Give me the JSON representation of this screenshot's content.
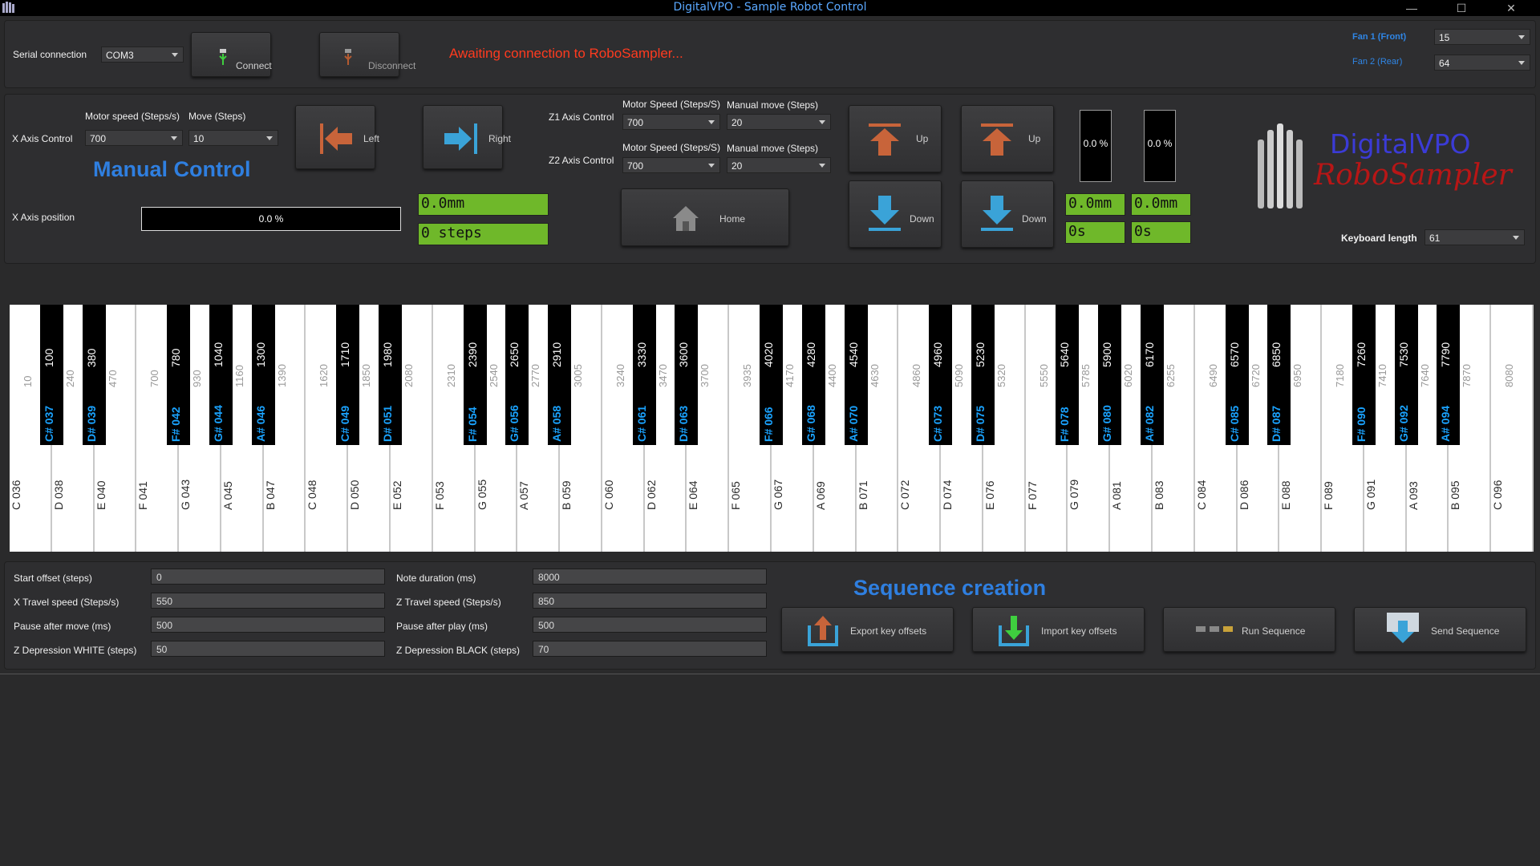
{
  "window": {
    "title": "DigitalVPO - Sample Robot Control",
    "minimize": "—",
    "maximize": "☐",
    "close": "✕"
  },
  "connection": {
    "serial_label": "Serial connection",
    "port_value": "COM3",
    "connect_label": "Connect",
    "disconnect_label": "Disconnect",
    "status_text": "Awaiting connection to RoboSampler...",
    "status_color": "#ff3b1f",
    "fan1_label": "Fan 1 (Front)",
    "fan1_value": "15",
    "fan2_label": "Fan 2 (Rear)",
    "fan2_value": "64"
  },
  "manual": {
    "heading": "Manual Control",
    "x_axis_label": "X Axis Control",
    "motor_speed_label": "Motor speed (Steps/s)",
    "motor_speed_value": "700",
    "move_label": "Move (Steps)",
    "move_value": "10",
    "left_label": "Left",
    "right_label": "Right",
    "x_position_label": "X Axis position",
    "x_position_value": "0.0 %",
    "x_position_fraction": 0.0,
    "x_mm": "0.0mm",
    "x_steps": "0 steps",
    "z1_label": "Z1 Axis Control",
    "z2_label": "Z2 Axis Control",
    "z_motor_speed_label": "Motor Speed (Steps/S)",
    "z_manual_move_label": "Manual move (Steps)",
    "z1_speed": "700",
    "z1_move": "20",
    "z2_speed": "700",
    "z2_move": "20",
    "home_label": "Home",
    "up_label": "Up",
    "down_label": "Down",
    "z1_pct": "0.0 %",
    "z2_pct": "0.0 %",
    "z1_mm": "0.0mm",
    "z2_mm": "0.0mm",
    "z1_time": "0s",
    "z2_time": "0s",
    "logo_line1": "DigitalVPO",
    "logo_line2": "RoboSampler",
    "keyboard_length_label": "Keyboard length",
    "keyboard_length_value": "61"
  },
  "keyboard": {
    "white_keys": [
      {
        "note": "C 036",
        "offset": "10"
      },
      {
        "note": "D 038",
        "offset": "240"
      },
      {
        "note": "E 040",
        "offset": "470"
      },
      {
        "note": "F 041",
        "offset": "700"
      },
      {
        "note": "G 043",
        "offset": "930"
      },
      {
        "note": "A 045",
        "offset": "1160"
      },
      {
        "note": "B 047",
        "offset": "1390"
      },
      {
        "note": "C 048",
        "offset": "1620"
      },
      {
        "note": "D 050",
        "offset": "1850"
      },
      {
        "note": "E 052",
        "offset": "2080"
      },
      {
        "note": "F 053",
        "offset": "2310"
      },
      {
        "note": "G 055",
        "offset": "2540"
      },
      {
        "note": "A 057",
        "offset": "2770"
      },
      {
        "note": "B 059",
        "offset": "3005"
      },
      {
        "note": "C 060",
        "offset": "3240"
      },
      {
        "note": "D 062",
        "offset": "3470"
      },
      {
        "note": "E 064",
        "offset": "3700"
      },
      {
        "note": "F 065",
        "offset": "3935"
      },
      {
        "note": "G 067",
        "offset": "4170"
      },
      {
        "note": "A 069",
        "offset": "4400"
      },
      {
        "note": "B 071",
        "offset": "4630"
      },
      {
        "note": "C 072",
        "offset": "4860"
      },
      {
        "note": "D 074",
        "offset": "5090"
      },
      {
        "note": "E 076",
        "offset": "5320"
      },
      {
        "note": "F 077",
        "offset": "5550"
      },
      {
        "note": "G 079",
        "offset": "5785"
      },
      {
        "note": "A 081",
        "offset": "6020"
      },
      {
        "note": "B 083",
        "offset": "6255"
      },
      {
        "note": "C 084",
        "offset": "6490"
      },
      {
        "note": "D 086",
        "offset": "6720"
      },
      {
        "note": "E 088",
        "offset": "6950"
      },
      {
        "note": "F 089",
        "offset": "7180"
      },
      {
        "note": "G 091",
        "offset": "7410"
      },
      {
        "note": "A 093",
        "offset": "7640"
      },
      {
        "note": "B 095",
        "offset": "7870"
      },
      {
        "note": "C 096",
        "offset": "8080"
      }
    ],
    "black_keys": [
      {
        "note": "C# 037",
        "offset": "100",
        "after": 0
      },
      {
        "note": "D# 039",
        "offset": "380",
        "after": 1
      },
      {
        "note": "F# 042",
        "offset": "780",
        "after": 3
      },
      {
        "note": "G# 044",
        "offset": "1040",
        "after": 4
      },
      {
        "note": "A# 046",
        "offset": "1300",
        "after": 5
      },
      {
        "note": "C# 049",
        "offset": "1710",
        "after": 7
      },
      {
        "note": "D# 051",
        "offset": "1980",
        "after": 8
      },
      {
        "note": "F# 054",
        "offset": "2390",
        "after": 10
      },
      {
        "note": "G# 056",
        "offset": "2650",
        "after": 11
      },
      {
        "note": "A# 058",
        "offset": "2910",
        "after": 12
      },
      {
        "note": "C# 061",
        "offset": "3330",
        "after": 14
      },
      {
        "note": "D# 063",
        "offset": "3600",
        "after": 15
      },
      {
        "note": "F# 066",
        "offset": "4020",
        "after": 17
      },
      {
        "note": "G# 068",
        "offset": "4280",
        "after": 18
      },
      {
        "note": "A# 070",
        "offset": "4540",
        "after": 19
      },
      {
        "note": "C# 073",
        "offset": "4960",
        "after": 21
      },
      {
        "note": "D# 075",
        "offset": "5230",
        "after": 22
      },
      {
        "note": "F# 078",
        "offset": "5640",
        "after": 24
      },
      {
        "note": "G# 080",
        "offset": "5900",
        "after": 25
      },
      {
        "note": "A# 082",
        "offset": "6170",
        "after": 26
      },
      {
        "note": "C# 085",
        "offset": "6570",
        "after": 28
      },
      {
        "note": "D# 087",
        "offset": "6850",
        "after": 29
      },
      {
        "note": "F# 090",
        "offset": "7260",
        "after": 31
      },
      {
        "note": "G# 092",
        "offset": "7530",
        "after": 32
      },
      {
        "note": "A# 094",
        "offset": "7790",
        "after": 33
      }
    ]
  },
  "sequence": {
    "heading": "Sequence creation",
    "start_offset_label": "Start offset (steps)",
    "start_offset_value": "0",
    "x_travel_label": "X Travel speed (Steps/s)",
    "x_travel_value": "550",
    "pause_move_label": "Pause after move (ms)",
    "pause_move_value": "500",
    "z_dep_white_label": "Z Depression WHITE (steps)",
    "z_dep_white_value": "50",
    "note_duration_label": "Note duration (ms)",
    "note_duration_value": "8000",
    "z_travel_label": "Z Travel speed (Steps/s)",
    "z_travel_value": "850",
    "pause_play_label": "Pause after play (ms)",
    "pause_play_value": "500",
    "z_dep_black_label": "Z Depression BLACK (steps)",
    "z_dep_black_value": "70",
    "export_label": "Export key offsets",
    "import_label": "Import key offsets",
    "run_label": "Run Sequence",
    "send_label": "Send Sequence"
  }
}
